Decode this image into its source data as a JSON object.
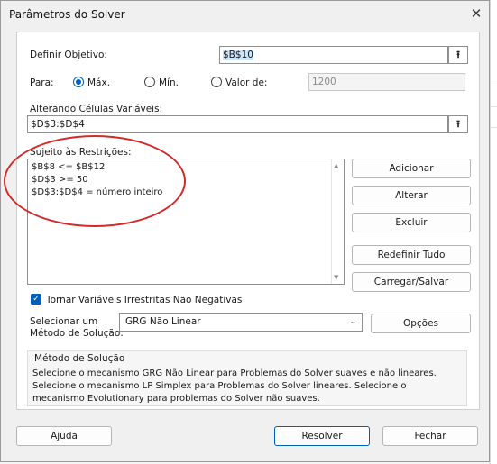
{
  "dialog": {
    "title": "Parâmetros do Solver",
    "close_icon": "close-icon"
  },
  "objective": {
    "label": "Definir Objetivo:",
    "value": "$B$10"
  },
  "to": {
    "label": "Para:",
    "max_label": "Máx.",
    "min_label": "Mín.",
    "value_of_label": "Valor de:",
    "value_of_value": "1200",
    "selected": "max"
  },
  "changing_cells": {
    "label": "Alterando Células Variáveis:",
    "value": "$D$3:$D$4"
  },
  "constraints": {
    "label": "Sujeito às Restrições:",
    "items": [
      "$B$8 <= $B$12",
      "$D$3 >= 50",
      "$D$3:$D$4 = número inteiro"
    ]
  },
  "buttons": {
    "add": "Adicionar",
    "change": "Alterar",
    "delete": "Excluir",
    "reset_all": "Redefinir Tudo",
    "load_save": "Carregar/Salvar",
    "options": "Opções",
    "help": "Ajuda",
    "solve": "Resolver",
    "close": "Fechar"
  },
  "nonnegative": {
    "label": "Tornar Variáveis Irrestritas Não Negativas",
    "checked": true
  },
  "method_select": {
    "label_line1": "Selecionar um",
    "label_line2": "Método de Solução:",
    "value": "GRG Não Linear"
  },
  "solving_method": {
    "heading": "Método de Solução",
    "description": "Selecione o mecanismo GRG Não Linear para Problemas do Solver suaves e não lineares. Selecione o mecanismo LP Simplex para Problemas do Solver lineares. Selecione o mecanismo Evolutionary para problemas do Solver não suaves."
  },
  "colors": {
    "accent": "#005fb8",
    "annotation": "#d42a2a"
  }
}
